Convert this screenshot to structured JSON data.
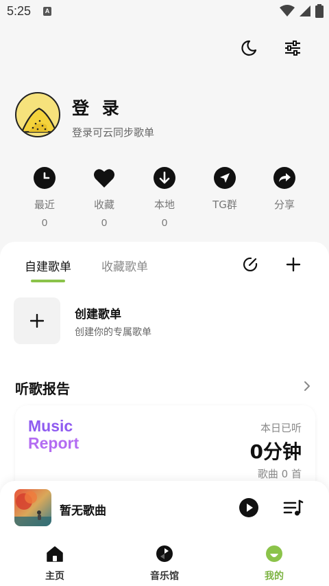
{
  "status_bar": {
    "time": "5:25",
    "notification_letter": "A"
  },
  "profile": {
    "title": "登 录",
    "subtitle": "登录可云同步歌单"
  },
  "shortcuts": [
    {
      "label": "最近",
      "count": "0",
      "icon": "clock-icon"
    },
    {
      "label": "收藏",
      "count": "0",
      "icon": "heart-icon"
    },
    {
      "label": "本地",
      "count": "0",
      "icon": "download-icon"
    },
    {
      "label": "TG群",
      "icon": "telegram-icon"
    },
    {
      "label": "分享",
      "icon": "share-icon"
    }
  ],
  "playlist_tabs": {
    "active": "自建歌单",
    "inactive": "收藏歌单"
  },
  "create_playlist": {
    "title": "创建歌单",
    "subtitle": "创建你的专属歌单"
  },
  "report": {
    "heading": "听歌报告",
    "logo_line1": "Music",
    "logo_line2": "Report",
    "today_label": "本日已听",
    "today_value": "0分钟",
    "today_songs": "歌曲 0 首"
  },
  "player": {
    "song_title": "暂无歌曲"
  },
  "bottom_nav": [
    {
      "label": "主页",
      "icon": "home-icon"
    },
    {
      "label": "音乐馆",
      "icon": "music-hall-icon"
    },
    {
      "label": "我的",
      "icon": "profile-icon",
      "active": true
    }
  ],
  "colors": {
    "accent": "#7cb342",
    "indicator": "#8bc34a",
    "logo_gradient": [
      "#8f5bf0",
      "#c06bf5"
    ]
  }
}
